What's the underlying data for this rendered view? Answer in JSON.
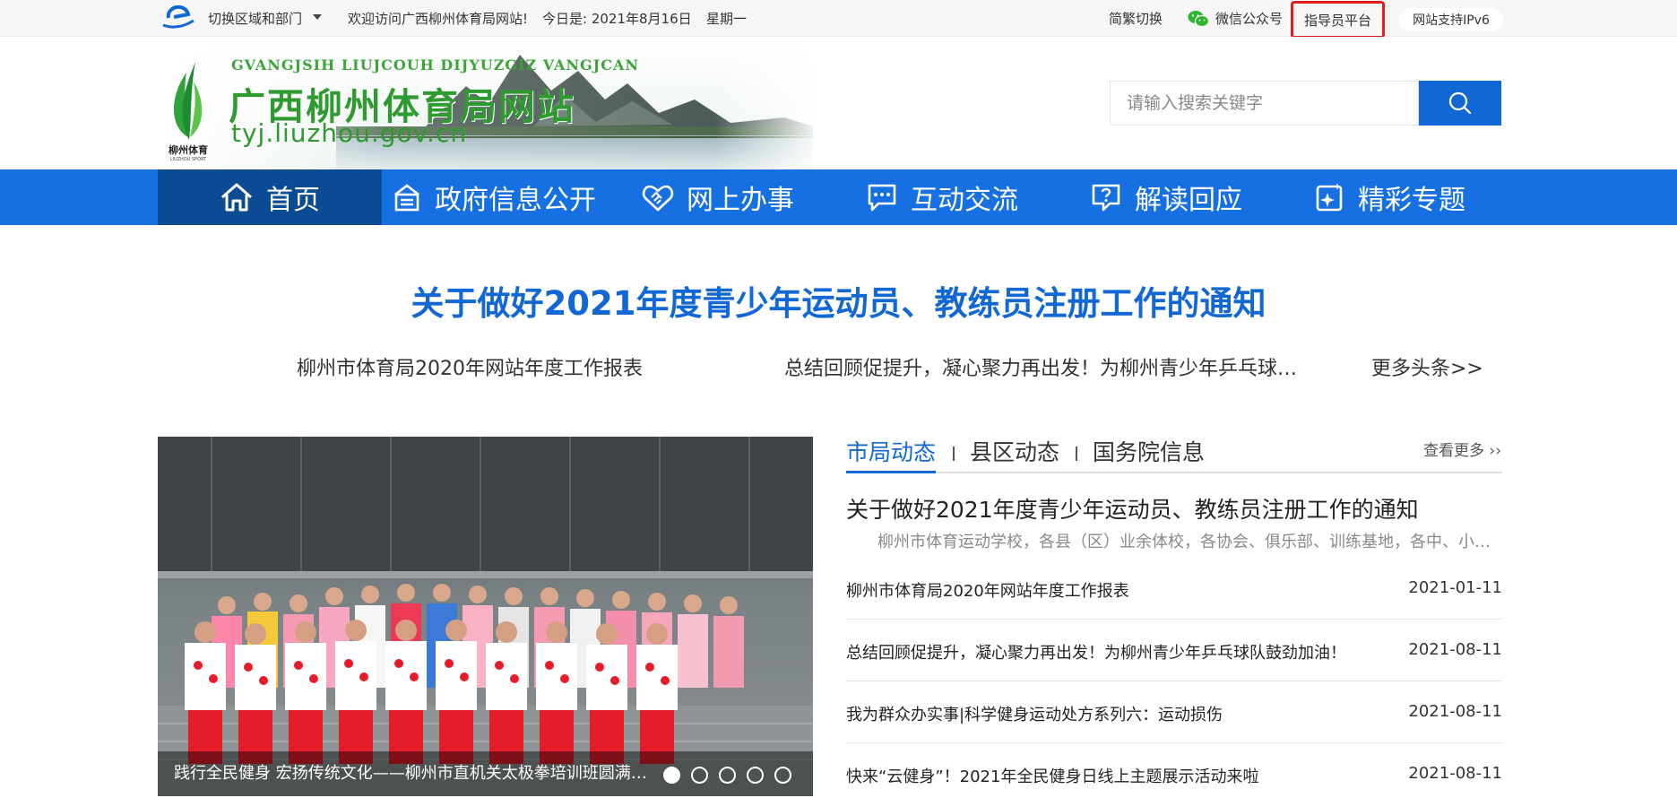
{
  "topbar": {
    "region_label": "切换区域和部门",
    "welcome": "欢迎访问广西柳州体育局网站!",
    "date": "今日是:  2021年8月16日",
    "weekday": "星期一",
    "trad_switch": "简繁切换",
    "wechat": "微信公众号",
    "guide_platform": "指导员平台",
    "ipv6": "网站支持IPv6"
  },
  "site": {
    "pinyin": "GVANGJSIH LIUJCOUH DIJYUZGIZ VANGJCAN",
    "title": "广西柳州体育局网站",
    "domain": "tyj.liuzhou.gov.cn",
    "emblem_text": "柳州体育",
    "emblem_sub": "LIUZHOU SPORT"
  },
  "search": {
    "placeholder": "请输入搜索关键字"
  },
  "nav": [
    {
      "label": "首页",
      "icon": "home-icon"
    },
    {
      "label": "政府信息公开",
      "icon": "building-icon"
    },
    {
      "label": "网上办事",
      "icon": "handshake-icon"
    },
    {
      "label": "互动交流",
      "icon": "chat-icon"
    },
    {
      "label": "解读回应",
      "icon": "question-chat-icon"
    },
    {
      "label": "精彩专题",
      "icon": "sparkle-icon"
    }
  ],
  "headline": {
    "title": "关于做好2021年度青少年运动员、教练员注册工作的通知",
    "sub1": "柳州市体育局2020年网站年度工作报表",
    "sub2": "总结回顾促提升，凝心聚力再出发！为柳州青少年乒乓球…",
    "more": "更多头条>>"
  },
  "slide": {
    "caption": "践行全民健身 宏扬传统文化——柳州市直机关太极拳培训班圆满结束",
    "total": 5,
    "active": 1
  },
  "news": {
    "tabs": [
      "市局动态",
      "县区动态",
      "国务院信息"
    ],
    "view_more": "查看更多 ››",
    "lead_title": "关于做好2021年度青少年运动员、教练员注册工作的通知",
    "lead_summary": "柳州市体育运动学校，各县（区）业余体校，各协会、俱乐部、训练基地，各中、小学…",
    "items": [
      {
        "title": "柳州市体育局2020年网站年度工作报表",
        "date": "2021-01-11"
      },
      {
        "title": "总结回顾促提升，凝心聚力再出发！为柳州青少年乒乓球队鼓劲加油！",
        "date": "2021-08-11"
      },
      {
        "title": "我为群众办实事|科学健身运动处方系列六：运动损伤",
        "date": "2021-08-11"
      },
      {
        "title": "快来“云健身”！2021年全民健身日线上主题展示活动来啦",
        "date": "2021-08-11"
      }
    ]
  },
  "colors": {
    "brand_blue": "#1167d4",
    "nav_blue": "#1670e2",
    "nav_active": "#0b4b93",
    "highlight_red": "#e02020",
    "site_green": "#2e9a2f"
  }
}
